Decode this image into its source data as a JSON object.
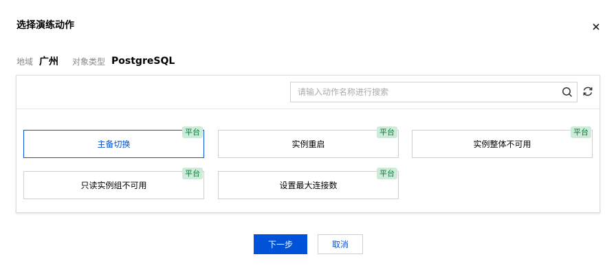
{
  "dialog": {
    "title": "选择演练动作"
  },
  "meta": {
    "region_label": "地域",
    "region_value": "广州",
    "object_type_label": "对象类型",
    "object_type_value": "PostgreSQL"
  },
  "search": {
    "placeholder": "请输入动作名称进行搜索",
    "value": ""
  },
  "actions": [
    {
      "label": "主备切换",
      "badge": "平台",
      "selected": true
    },
    {
      "label": "实例重启",
      "badge": "平台",
      "selected": false
    },
    {
      "label": "实例整体不可用",
      "badge": "平台",
      "selected": false
    },
    {
      "label": "只读实例组不可用",
      "badge": "平台",
      "selected": false
    },
    {
      "label": "设置最大连接数",
      "badge": "平台",
      "selected": false
    }
  ],
  "footer": {
    "next_label": "下一步",
    "cancel_label": "取消"
  },
  "colors": {
    "primary": "#0052d9",
    "badge_bg": "#cdebd8",
    "badge_text": "#0b7a3b"
  },
  "icons": [
    "close-icon",
    "search-icon",
    "refresh-icon"
  ]
}
